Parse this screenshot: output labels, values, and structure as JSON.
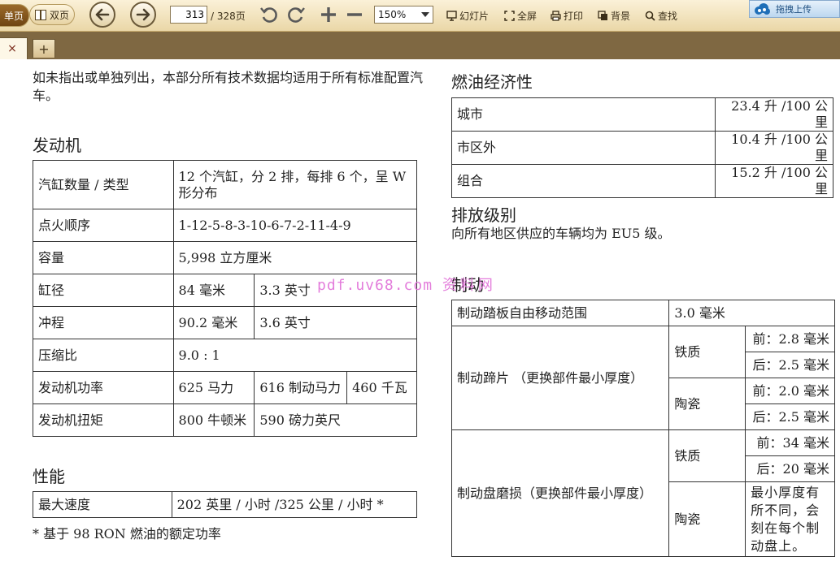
{
  "toolbar": {
    "single_page_label": "单页",
    "double_page_label": "双页",
    "current_page": "313",
    "total_pages": "/ 328页",
    "zoom_value": "150%",
    "slideshow_label": "幻灯片",
    "fullscreen_label": "全屏",
    "print_label": "打印",
    "background_label": "背景",
    "find_label": "查找",
    "upload_label": "拖拽上传"
  },
  "tabs": {
    "close_glyph": "×",
    "add_glyph": "+"
  },
  "watermark": {
    "url": "pdf.uv68.com",
    "text": "资料网"
  },
  "doc": {
    "intro": "如未指出或单独列出，本部分所有技术数据均适用于所有标准配置汽车。",
    "engine": {
      "heading": "发动机",
      "rows": [
        {
          "label": "汽缸数量 / 类型",
          "v1": "12 个汽缸，分 2 排，每排 6 个，呈 W 形分布"
        },
        {
          "label": "点火顺序",
          "v1": "1-12-5-8-3-10-6-7-2-11-4-9"
        },
        {
          "label": "容量",
          "v1": "5,998 立方厘米"
        },
        {
          "label": "缸径",
          "v1": "84 毫米",
          "v2": "3.3 英寸"
        },
        {
          "label": "冲程",
          "v1": "90.2 毫米",
          "v2": "3.6 英寸"
        },
        {
          "label": "压缩比",
          "v1": "9.0 : 1"
        },
        {
          "label": "发动机功率",
          "v1": "625 马力",
          "v2": "616 制动马力",
          "v3": "460 千瓦"
        },
        {
          "label": "发动机扭矩",
          "v1": "800 牛顿米",
          "v2": "590 磅力英尺"
        }
      ]
    },
    "performance": {
      "heading": "性能",
      "rows": [
        {
          "label": "最大速度",
          "value": "202 英里 / 小时 /325 公里 / 小时 *"
        }
      ],
      "footnote": "* 基于 98 RON 燃油的额定功率"
    },
    "fuel": {
      "heading": "燃油经济性",
      "rows": [
        {
          "label": "城市",
          "value": "23.4 升 /100 公里"
        },
        {
          "label": "市区外",
          "value": "10.4 升 /100 公里"
        },
        {
          "label": "组合",
          "value": "15.2 升 /100 公里"
        }
      ]
    },
    "emission": {
      "heading": "排放级别",
      "text": "向所有地区供应的车辆均为 EU5 级。"
    },
    "brake": {
      "heading": "制动",
      "pedal_label": "制动踏板自由移动范围",
      "pedal_value": "3.0 毫米",
      "pad_label": "制动蹄片 （更换部件最小厚度）",
      "pad_iron": "铁质",
      "pad_iron_front": "前：2.8 毫米",
      "pad_iron_rear": "后：2.5 毫米",
      "pad_ceramic": "陶瓷",
      "pad_ceramic_front": "前：2.0 毫米",
      "pad_ceramic_rear": "后：2.5 毫米",
      "disc_label": "制动盘磨损（更换部件最小厚度）",
      "disc_iron": "铁质",
      "disc_iron_front": "前：34 毫米",
      "disc_iron_rear": "后：20 毫米",
      "disc_ceramic": "陶瓷",
      "disc_ceramic_note": "最小厚度有所不同，会刻在每个制动盘上。"
    }
  }
}
